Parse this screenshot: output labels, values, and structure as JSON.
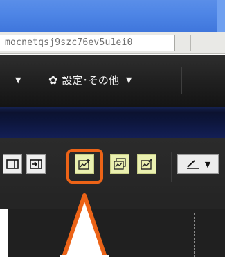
{
  "browser": {
    "address_text": "mocnetqsj9szc76ev5u1ei0"
  },
  "menu": {
    "left_arrow": "▼",
    "settings_label": "設定･その他",
    "settings_arrow": "▼"
  },
  "toolbar": {
    "buttons": [
      {
        "icon": "panel-right-icon"
      },
      {
        "icon": "arrow-into-panel-icon"
      },
      {
        "icon": "add-chart-icon",
        "highlighted": true
      },
      {
        "icon": "chart-window-icon"
      },
      {
        "icon": "chart-edit-icon"
      }
    ],
    "pen_dropdown_arrow": "▼"
  },
  "colors": {
    "highlight": "#ec6317",
    "toolbar_yellow": "#eaf0b0",
    "titlebar_blue": "#4f86e6",
    "menubar_dark": "#1f1f1f"
  }
}
